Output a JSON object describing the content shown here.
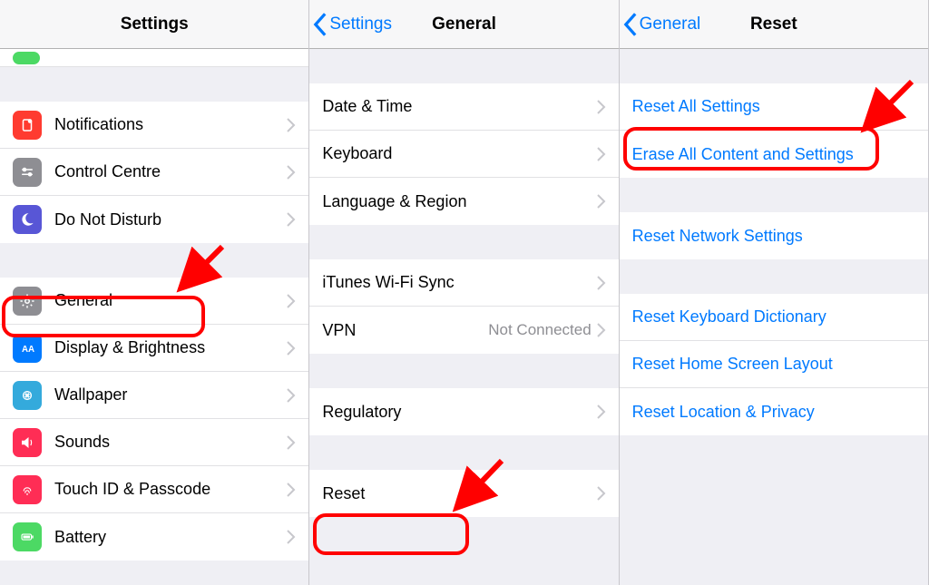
{
  "pane1": {
    "title": "Settings",
    "rows": [
      {
        "label": "Notifications"
      },
      {
        "label": "Control Centre"
      },
      {
        "label": "Do Not Disturb"
      },
      {
        "label": "General"
      },
      {
        "label": "Display & Brightness"
      },
      {
        "label": "Wallpaper"
      },
      {
        "label": "Sounds"
      },
      {
        "label": "Touch ID & Passcode"
      },
      {
        "label": "Battery"
      }
    ]
  },
  "pane2": {
    "back": "Settings",
    "title": "General",
    "rows": [
      {
        "label": "Date & Time"
      },
      {
        "label": "Keyboard"
      },
      {
        "label": "Language & Region"
      },
      {
        "label": "iTunes Wi-Fi Sync"
      },
      {
        "label": "VPN",
        "detail": "Not Connected"
      },
      {
        "label": "Regulatory"
      },
      {
        "label": "Reset"
      }
    ]
  },
  "pane3": {
    "back": "General",
    "title": "Reset",
    "rows": [
      {
        "label": "Reset All Settings"
      },
      {
        "label": "Erase All Content and Settings"
      },
      {
        "label": "Reset Network Settings"
      },
      {
        "label": "Reset Keyboard Dictionary"
      },
      {
        "label": "Reset Home Screen Layout"
      },
      {
        "label": "Reset Location & Privacy"
      }
    ]
  }
}
